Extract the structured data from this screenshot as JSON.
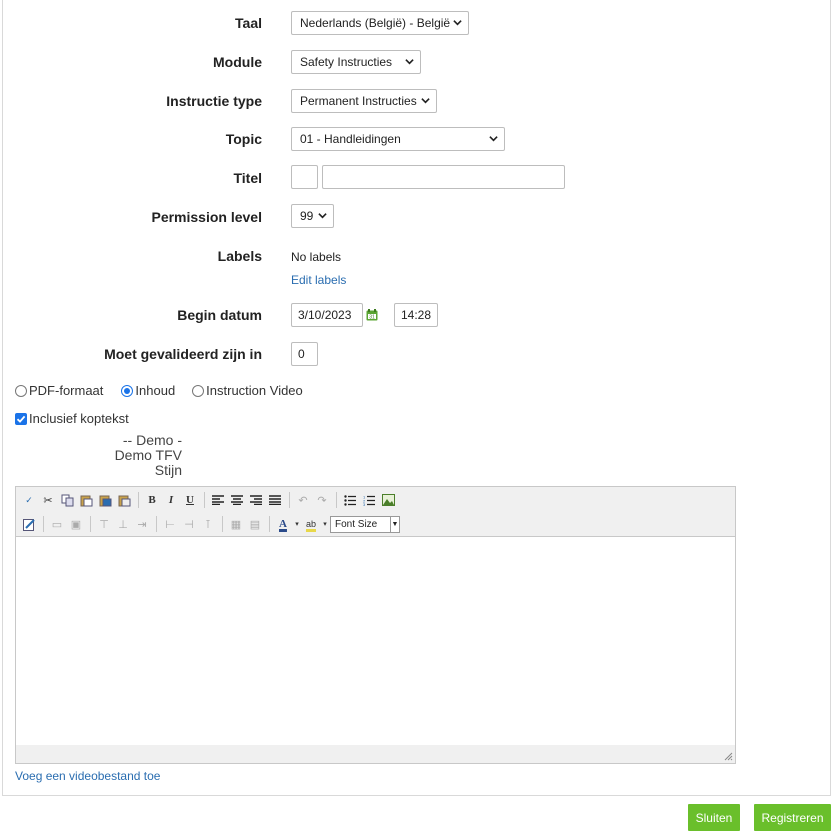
{
  "form": {
    "taal": {
      "label": "Taal",
      "value": "Nederlands (België) - België"
    },
    "module": {
      "label": "Module",
      "value": "Safety Instructies"
    },
    "instructie_type": {
      "label": "Instructie type",
      "value": "Permanent Instructies"
    },
    "topic": {
      "label": "Topic",
      "value": "01 - Handleidingen"
    },
    "titel": {
      "label": "Titel",
      "prefix": "",
      "value": ""
    },
    "permission": {
      "label": "Permission level",
      "value": "99"
    },
    "labels": {
      "label": "Labels",
      "value": "No labels",
      "edit_link": "Edit labels"
    },
    "begin_datum": {
      "label": "Begin datum",
      "date": "3/10/2023",
      "time": "14:28"
    },
    "gevalideerd": {
      "label": "Moet gevalideerd zijn in",
      "value": "0"
    }
  },
  "content_type": {
    "options": [
      "PDF-formaat",
      "Inhoud",
      "Instruction Video"
    ],
    "selected": "Inhoud"
  },
  "header_toggle": {
    "label": "Inclusief koptekst",
    "checked": true
  },
  "header_text": {
    "line1": "-- Demo -",
    "line2": "Demo TFV",
    "line3": "Stijn"
  },
  "editor": {
    "font_size_label": "Font Size",
    "content": ""
  },
  "video_link": "Voeg een videobestand toe",
  "buttons": {
    "close": "Sluiten",
    "register": "Registreren"
  },
  "colors": {
    "accent_button": "#6abf2b",
    "link": "#2a6db0",
    "calendar": "#5aa532"
  }
}
